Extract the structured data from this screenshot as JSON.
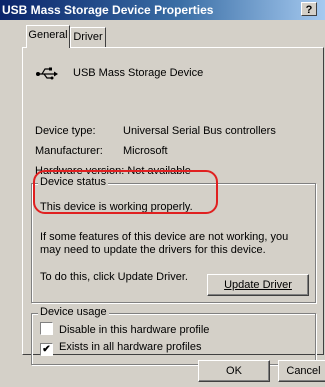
{
  "window": {
    "title": "USB Mass Storage Device Properties",
    "help_label": "?"
  },
  "tabs": [
    {
      "label": "General",
      "active": true
    },
    {
      "label": "Driver",
      "active": false
    }
  ],
  "device": {
    "icon": "usb-icon",
    "name": "USB Mass Storage Device"
  },
  "properties": {
    "type_label": "Device type:",
    "type_value": "Universal Serial Bus controllers",
    "manufacturer_label": "Manufacturer:",
    "manufacturer_value": "Microsoft",
    "hardware_label": "Hardware version:",
    "hardware_value": "Not available"
  },
  "status": {
    "group_label": "Device status",
    "text": "This device is working properly.",
    "info": "If some features of this device are not working, you may need to update the drivers for this device.",
    "todo": "To do this, click Update Driver.",
    "update_button": "Update Driver",
    "highlight_color": "#e02020"
  },
  "usage": {
    "group_label": "Device usage",
    "options": [
      {
        "label": "Disable in this hardware profile",
        "checked": false
      },
      {
        "label": "Exists in all hardware profiles",
        "checked": true
      }
    ]
  },
  "footer": {
    "ok_label": "OK",
    "cancel_label": "Cancel"
  },
  "colors": {
    "dialog_bg": "#d4d0c8",
    "title_start": "#0a246a",
    "title_end": "#a6caf0"
  }
}
